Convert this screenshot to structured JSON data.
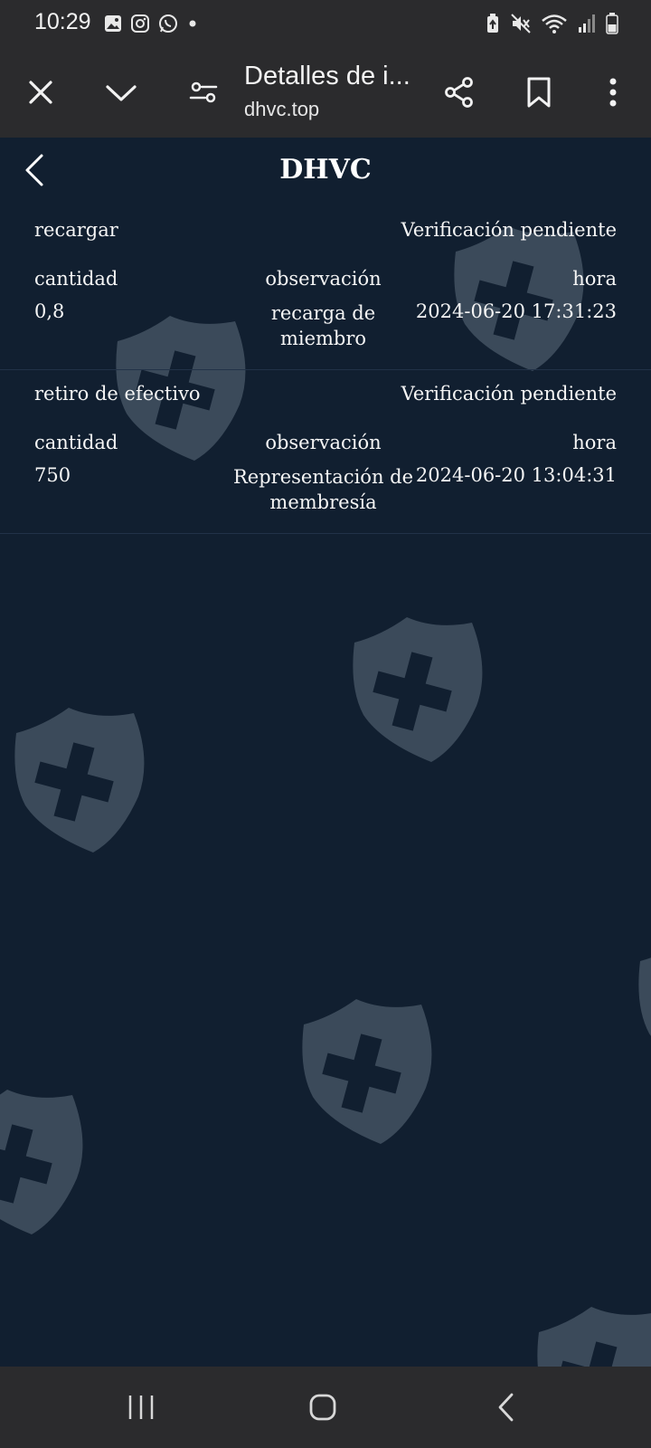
{
  "status_bar": {
    "time": "10:29",
    "left_icons": [
      "gallery-icon",
      "instagram-icon",
      "whatsapp-icon",
      "dot-icon"
    ],
    "right_icons": [
      "battery-saver-icon",
      "mute-icon",
      "wifi-icon",
      "signal-icon",
      "battery-icon"
    ]
  },
  "browser": {
    "page_title": "Detalles de i...",
    "url": "dhvc.top",
    "icons": [
      "close-icon",
      "chevron-down-icon",
      "page-settings-icon",
      "share-icon",
      "bookmark-icon",
      "more-icon"
    ]
  },
  "page": {
    "title": "DHVC",
    "records": [
      {
        "type": "recargar",
        "status": "Verificación pendiente",
        "amount_label": "cantidad",
        "note_label": "observación",
        "time_label": "hora",
        "amount": "0,8",
        "note": "recarga de miembro",
        "time": "2024-06-20 17:31:23"
      },
      {
        "type": "retiro de efectivo",
        "status": "Verificación pendiente",
        "amount_label": "cantidad",
        "note_label": "observación",
        "time_label": "hora",
        "amount": "750",
        "note": "Representación de membresía",
        "time": "2024-06-20 13:04:31"
      }
    ]
  },
  "colors": {
    "background": "#111f30",
    "bars": "#2b2b2d",
    "watermark": "#8a9aa8",
    "text": "#ffffff"
  }
}
